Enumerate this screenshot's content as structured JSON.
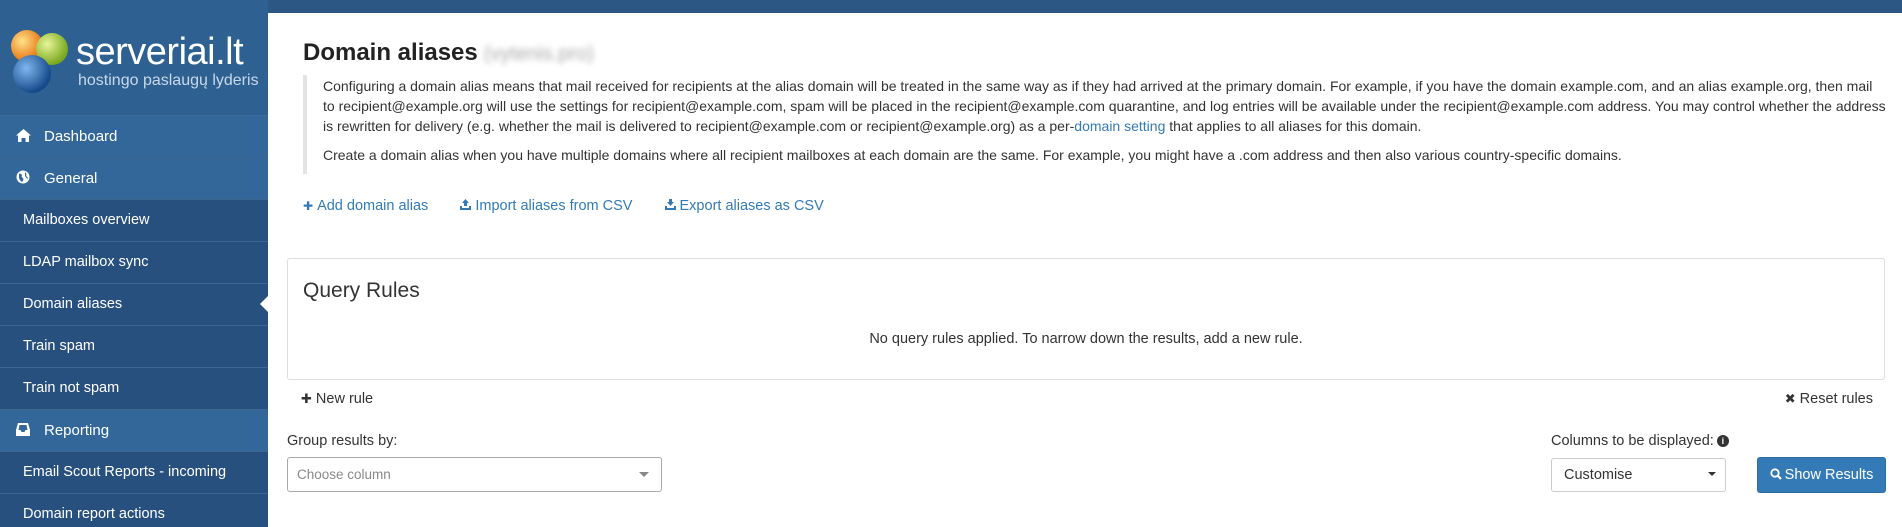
{
  "brand": {
    "name": "serveriai.lt",
    "tagline": "hostingo paslaugų lyderis"
  },
  "sidebar": {
    "items": [
      {
        "label": "Dashboard",
        "icon": "home-icon",
        "level": "top"
      },
      {
        "label": "General",
        "icon": "globe-icon",
        "level": "top"
      },
      {
        "label": "Mailboxes overview",
        "level": "sub"
      },
      {
        "label": "LDAP mailbox sync",
        "level": "sub"
      },
      {
        "label": "Domain aliases",
        "level": "sub",
        "active": true
      },
      {
        "label": "Train spam",
        "level": "sub"
      },
      {
        "label": "Train not spam",
        "level": "sub"
      },
      {
        "label": "Reporting",
        "icon": "inbox-icon",
        "level": "top"
      },
      {
        "label": "Email Scout Reports - incoming",
        "level": "sub"
      },
      {
        "label": "Domain report actions",
        "level": "sub"
      }
    ]
  },
  "page": {
    "title": "Domain aliases",
    "domain_blurred": "(vytenis.pro)",
    "desc1_a": "Configuring a domain alias means that mail received for recipients at the alias domain will be treated in the same way as if they had arrived at the primary domain. For example, if you have the domain example.com, and an alias example.org, then mail to recipient@example.org will use the settings for recipient@example.com, spam will be placed in the recipient@example.com quarantine, and log entries will be available under the recipient@example.com address. You may control whether the address is rewritten for delivery (e.g. whether the mail is delivered to recipient@example.com or recipient@example.org) as a per-",
    "desc1_link": "domain setting",
    "desc1_b": " that applies to all aliases for this domain.",
    "desc2": "Create a domain alias when you have multiple domains where all recipient mailboxes at each domain are the same. For example, you might have a .com address and then also various country-specific domains."
  },
  "actions": {
    "add": "Add domain alias",
    "import": "Import aliases from CSV",
    "export": "Export aliases as CSV"
  },
  "query_rules": {
    "title": "Query Rules",
    "empty": "No query rules applied. To narrow down the results, add a new rule.",
    "new_rule": "New rule",
    "reset_rules": "Reset rules"
  },
  "controls": {
    "group_label": "Group results by:",
    "group_placeholder": "Choose column",
    "columns_label": "Columns to be displayed:",
    "columns_value": "Customise",
    "show_results": "Show Results"
  },
  "colors": {
    "sidebar": "#2c5684",
    "accent": "#337ab7"
  }
}
